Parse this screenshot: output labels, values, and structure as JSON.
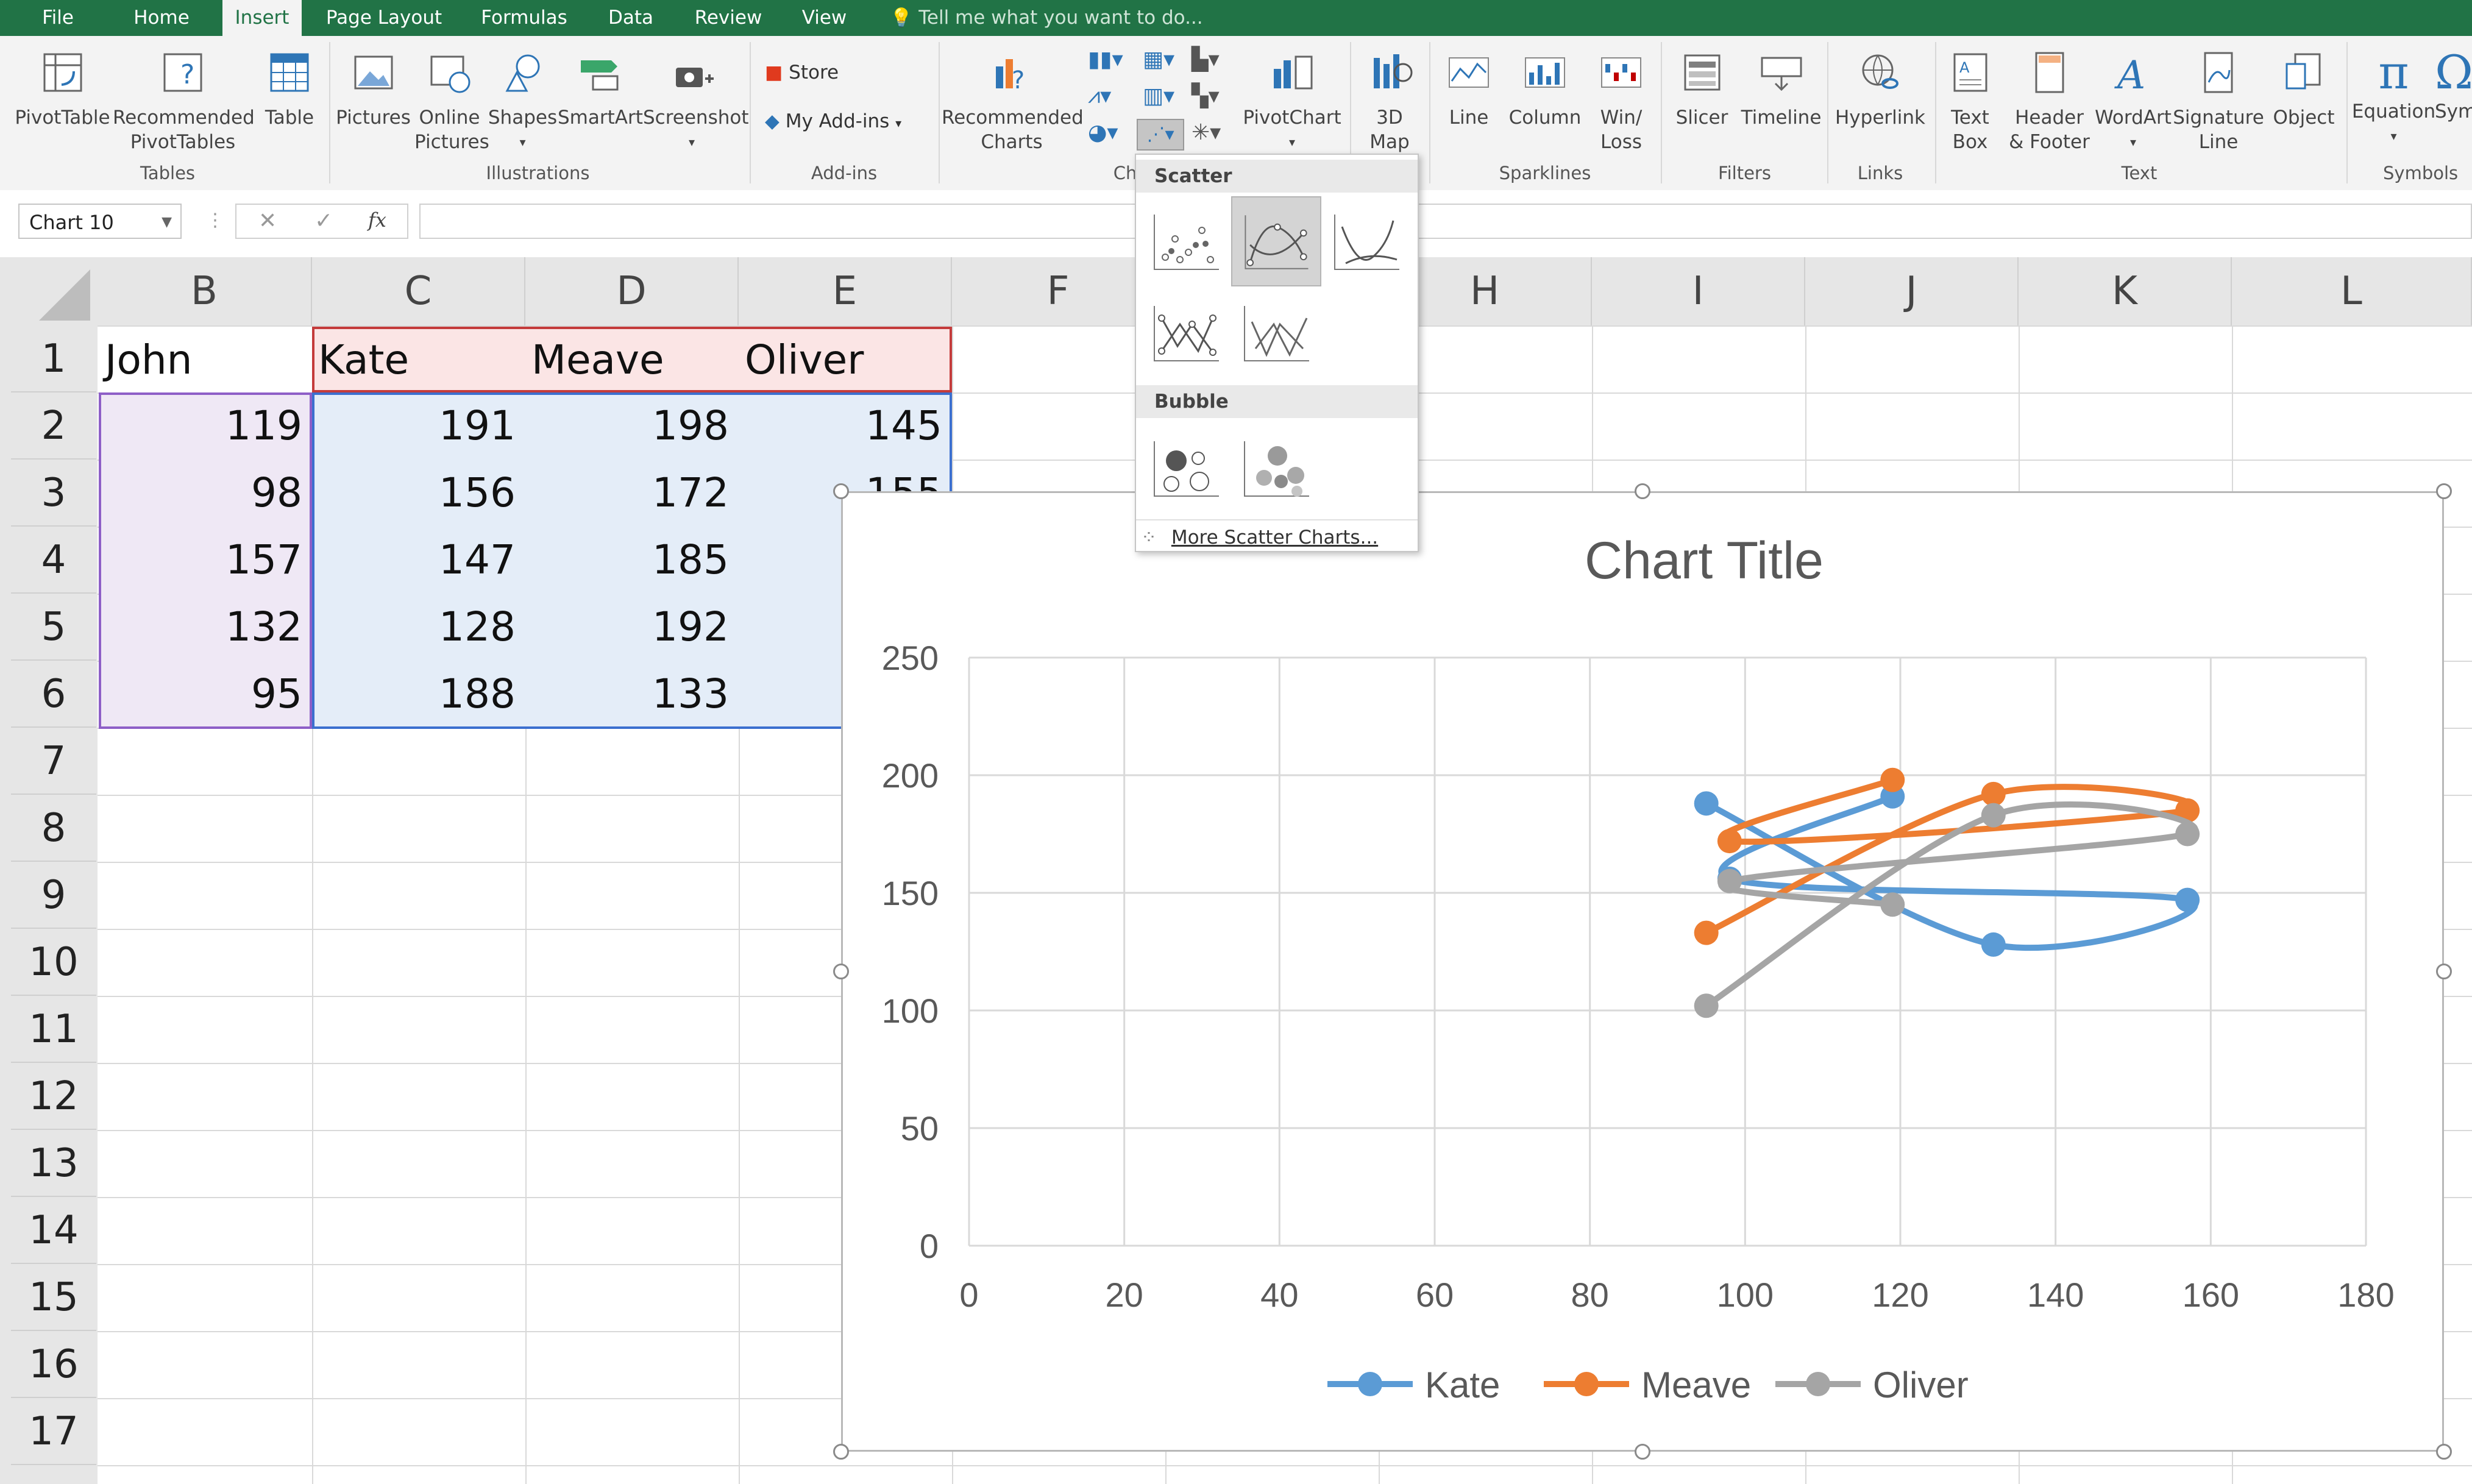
{
  "tabs": [
    "File",
    "Home",
    "Insert",
    "Page Layout",
    "Formulas",
    "Data",
    "Review",
    "View"
  ],
  "active_tab": "Insert",
  "tell_me": "Tell me what you want to do...",
  "ribbon": {
    "tables": {
      "pivottable": "PivotTable",
      "recommended_pivottables": "Recommended\nPivotTables",
      "table": "Table",
      "group": "Tables"
    },
    "illustrations": {
      "pictures": "Pictures",
      "online_pictures": "Online\nPictures",
      "shapes": "Shapes",
      "smartart": "SmartArt",
      "screenshot": "Screenshot",
      "group": "Illustrations"
    },
    "addins": {
      "store": "Store",
      "my_addins": "My Add-ins",
      "group": "Add-ins"
    },
    "charts": {
      "recommended_charts": "Recommended\nCharts",
      "pivotchart": "PivotChart",
      "group": "Cha"
    },
    "tours": {
      "map3d": "3D\nMap"
    },
    "sparklines": {
      "line": "Line",
      "column": "Column",
      "winloss": "Win/\nLoss",
      "group": "Sparklines"
    },
    "filters": {
      "slicer": "Slicer",
      "timeline": "Timeline",
      "group": "Filters"
    },
    "links": {
      "hyperlink": "Hyperlink",
      "group": "Links"
    },
    "text": {
      "text_box": "Text\nBox",
      "header_footer": "Header\n& Footer",
      "wordart": "WordArt",
      "signature_line": "Signature\nLine",
      "object": "Object",
      "group": "Text"
    },
    "symbols": {
      "equation": "Equation",
      "symbol": "Sym",
      "group": "Symbols"
    }
  },
  "formula_bar": {
    "name_box": "Chart 10",
    "fx": "fx",
    "cancel": "✕",
    "enter": "✓",
    "value": ""
  },
  "columns": [
    "B",
    "C",
    "D",
    "E",
    "F",
    "",
    "H",
    "I",
    "J",
    "K",
    "L"
  ],
  "rows": [
    "1",
    "2",
    "3",
    "4",
    "5",
    "6",
    "7",
    "8",
    "9",
    "10",
    "11",
    "12",
    "13",
    "14",
    "15",
    "16",
    "17"
  ],
  "table": {
    "headers": [
      "John",
      "Kate",
      "Meave",
      "Oliver"
    ],
    "rows": [
      [
        "119",
        "191",
        "198",
        "145"
      ],
      [
        "98",
        "156",
        "172",
        "155"
      ],
      [
        "157",
        "147",
        "185",
        ""
      ],
      [
        "132",
        "128",
        "192",
        ""
      ],
      [
        "95",
        "188",
        "133",
        ""
      ]
    ]
  },
  "dropdown": {
    "scatter_header": "Scatter",
    "bubble_header": "Bubble",
    "more": "More Scatter Charts..."
  },
  "colors": {
    "kate": "#5b9bd5",
    "meave": "#ed7d31",
    "oliver": "#a5a5a5",
    "ribbon_green": "#217346"
  },
  "chart_data": {
    "type": "scatter",
    "subtype": "scatter with smooth lines and markers",
    "title": "Chart Title",
    "xlim": [
      0,
      180
    ],
    "ylim": [
      0,
      250
    ],
    "xticks": [
      "0",
      "20",
      "40",
      "60",
      "80",
      "100",
      "120",
      "140",
      "160",
      "180"
    ],
    "yticks": [
      "0",
      "50",
      "100",
      "150",
      "200",
      "250"
    ],
    "grid": true,
    "legend_position": "bottom",
    "series": [
      {
        "name": "Kate",
        "x": [
          119,
          98,
          157,
          132,
          95
        ],
        "y": [
          191,
          156,
          147,
          128,
          188
        ]
      },
      {
        "name": "Meave",
        "x": [
          119,
          98,
          157,
          132,
          95
        ],
        "y": [
          198,
          172,
          185,
          192,
          133
        ]
      },
      {
        "name": "Oliver",
        "x": [
          119,
          98,
          157,
          132,
          95
        ],
        "y": [
          145,
          155,
          175,
          183,
          102
        ]
      }
    ]
  }
}
